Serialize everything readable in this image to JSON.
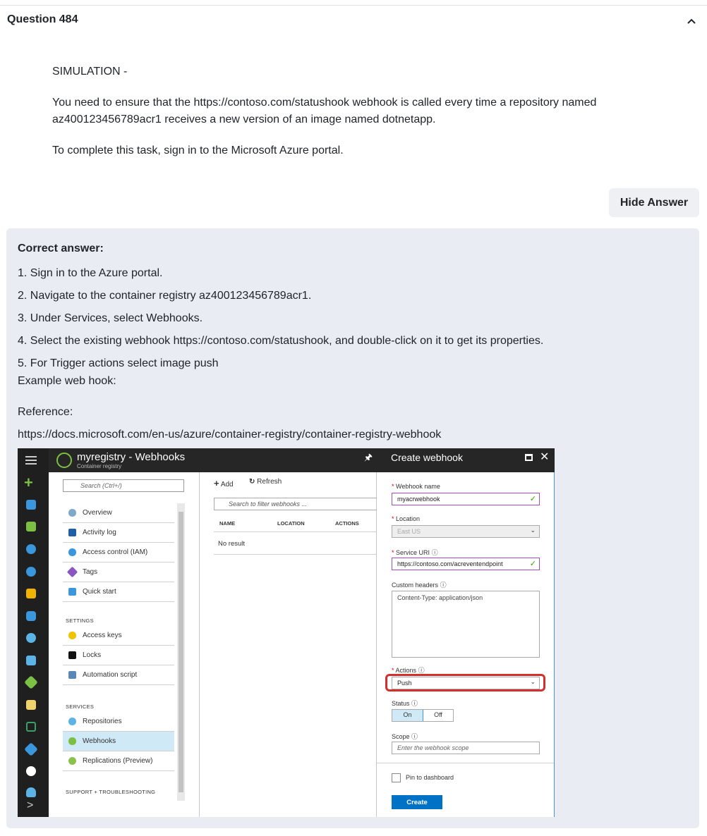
{
  "question": {
    "title": "Question 484",
    "paragraphs": [
      "SIMULATION -",
      "You need to ensure that the https://contoso.com/statushook webhook is called every time a repository named az400123456789acr1 receives a new version of an image named dotnetapp.",
      "To complete this task, sign in to the Microsoft Azure portal."
    ],
    "hide_answer_label": "Hide Answer"
  },
  "answer": {
    "title": "Correct answer:",
    "steps": [
      "1. Sign in to the Azure portal.",
      "2. Navigate to the container registry az400123456789acr1.",
      "3. Under Services, select Webhooks.",
      "4. Select the existing webhook https://contoso.com/statushook, and double-click on it to get its properties.",
      "5. For Trigger actions select image push"
    ],
    "example_label": "Example web hook:",
    "reference_label": "Reference:",
    "reference_url": "https://docs.microsoft.com/en-us/azure/container-registry/container-registry-webhook"
  },
  "azure": {
    "blade_title": "myregistry - Webhooks",
    "blade_subtitle": "Container registry",
    "menu_search_placeholder": "Search (Ctrl+/)",
    "menu_items": [
      {
        "label": "Overview",
        "icon": "cloud-icon"
      },
      {
        "label": "Activity log",
        "icon": "log-icon"
      },
      {
        "label": "Access control (IAM)",
        "icon": "people-icon"
      },
      {
        "label": "Tags",
        "icon": "tag-icon"
      },
      {
        "label": "Quick start",
        "icon": "quickstart-icon"
      }
    ],
    "settings_header": "SETTINGS",
    "settings_items": [
      {
        "label": "Access keys",
        "icon": "key-icon"
      },
      {
        "label": "Locks",
        "icon": "lock-icon"
      },
      {
        "label": "Automation script",
        "icon": "script-icon"
      }
    ],
    "services_header": "SERVICES",
    "services_items": [
      {
        "label": "Repositories",
        "icon": "cloud-icon"
      },
      {
        "label": "Webhooks",
        "icon": "webhook-icon"
      },
      {
        "label": "Replications (Preview)",
        "icon": "globe-icon"
      }
    ],
    "support_header": "SUPPORT + TROUBLESHOOTING",
    "toolbar": {
      "add": "Add",
      "refresh": "Refresh"
    },
    "list_search_placeholder": "Search to filter webhooks ...",
    "columns": [
      "NAME",
      "LOCATION",
      "ACTIONS"
    ],
    "no_result": "No result",
    "create_title": "Create webhook",
    "form": {
      "name_label": "Webhook name",
      "name_value": "myacrwebhook",
      "location_label": "Location",
      "location_value": "East US",
      "uri_label": "Service URI",
      "uri_value": "https://contoso.com/acreventendpoint",
      "headers_label": "Custom headers",
      "headers_value": "Content-Type: application/json",
      "actions_label": "Actions",
      "actions_value": "Push",
      "status_label": "Status",
      "status_on": "On",
      "status_off": "Off",
      "scope_label": "Scope",
      "scope_placeholder": "Enter the webhook scope",
      "pin_label": "Pin to dashboard",
      "create_label": "Create"
    }
  }
}
